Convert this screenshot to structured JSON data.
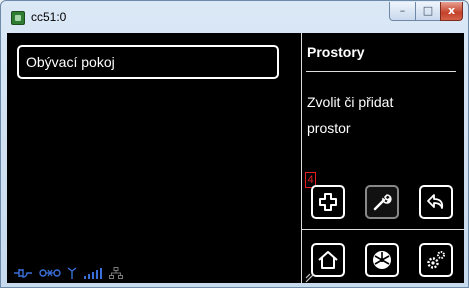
{
  "window": {
    "title": "cc51:0",
    "controls": {
      "minimize": "–",
      "maximize": "□",
      "close": "x"
    }
  },
  "rooms": [
    {
      "label": "Obývací pokoj"
    }
  ],
  "panel": {
    "title": "Prostory",
    "description_line1": "Zvolit či přidat",
    "description_line2": "prostor"
  },
  "marker": {
    "label": "4"
  },
  "actions": [
    {
      "icon": "plus-icon"
    },
    {
      "icon": "wrench-icon"
    },
    {
      "icon": "back-arrow-icon"
    }
  ],
  "nav": [
    {
      "icon": "home-icon"
    },
    {
      "icon": "fan-icon"
    },
    {
      "icon": "gears-icon"
    }
  ],
  "colors": {
    "accent": "#4a7bd0",
    "status": "#3a6fd8"
  }
}
